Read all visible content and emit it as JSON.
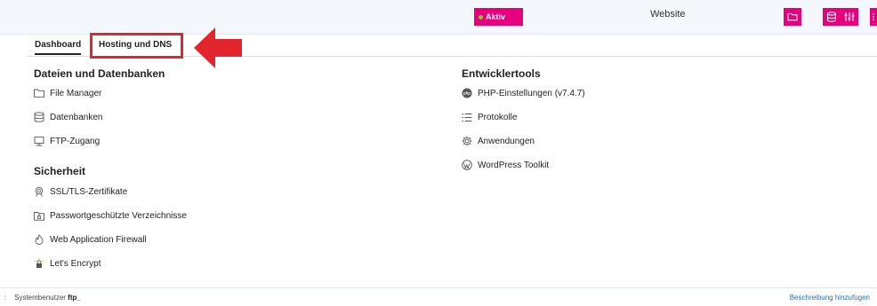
{
  "header": {
    "status": "Aktiv",
    "site_label": "Website"
  },
  "tabs": [
    {
      "label": "Dashboard"
    },
    {
      "label": "Hosting und DNS"
    }
  ],
  "left": {
    "files_title": "Dateien und Datenbanken",
    "files_items": [
      {
        "label": "File Manager",
        "icon": "folder-icon"
      },
      {
        "label": "Datenbanken",
        "icon": "database-icon"
      },
      {
        "label": "FTP-Zugang",
        "icon": "ftp-icon"
      }
    ],
    "security_title": "Sicherheit",
    "security_items": [
      {
        "label": "SSL/TLS-Zertifikate",
        "icon": "certificate-icon"
      },
      {
        "label": "Passwortgeschützte Verzeichnisse",
        "icon": "locked-folder-icon"
      },
      {
        "label": "Web Application Firewall",
        "icon": "firewall-icon"
      },
      {
        "label": "Let's Encrypt",
        "icon": "letsencrypt-icon"
      }
    ]
  },
  "right": {
    "dev_title": "Entwicklertools",
    "dev_items": [
      {
        "label": "PHP-Einstellungen (v7.4.7)",
        "icon": "php-icon"
      },
      {
        "label": "Protokolle",
        "icon": "list-icon"
      },
      {
        "label": "Anwendungen",
        "icon": "gear-icon"
      },
      {
        "label": "WordPress Toolkit",
        "icon": "wordpress-icon"
      }
    ]
  },
  "footer": {
    "prefix": ":",
    "system_user_label": "Systembenutzer",
    "system_user_value": "ftp_",
    "add_description": "Beschreibung hinzufügen"
  },
  "colors": {
    "accent": "#e6007e",
    "highlight": "#e3262e",
    "link": "#1f6fbf"
  }
}
